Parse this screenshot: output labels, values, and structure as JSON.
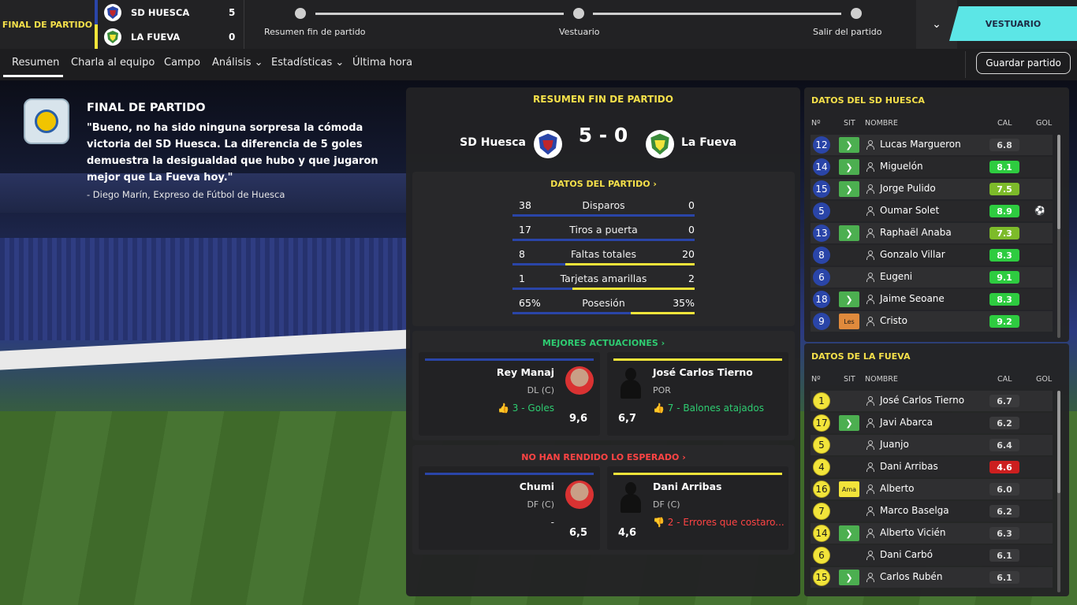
{
  "header": {
    "status": "FINAL DE PARTIDO",
    "home": {
      "name": "SD HUESCA",
      "score": "5",
      "color": "#2a45a8"
    },
    "away": {
      "name": "LA FUEVA",
      "score": "0",
      "color": "#f2e43a"
    },
    "steps": [
      "Resumen fin de partido",
      "Vestuario",
      "Salir del partido"
    ],
    "cta": "VESTUARIO"
  },
  "nav": {
    "tabs": [
      "Resumen",
      "Charla al equipo",
      "Campo",
      "Análisis",
      "Estadísticas",
      "Última hora"
    ],
    "save": "Guardar partido"
  },
  "quote": {
    "title": "FINAL DE PARTIDO",
    "text": "\"Bueno, no ha sido ninguna sorpresa la cómoda victoria del SD Huesca. La diferencia de 5 goles demuestra la desigualdad que hubo y que jugaron mejor que La Fueva hoy.\"",
    "source": "- Diego Marín, Expreso de Fútbol de Huesca"
  },
  "summary": {
    "title": "RESUMEN FIN DE PARTIDO",
    "home_team": "SD Huesca",
    "away_team": "La Fueva",
    "score": "5 - 0",
    "match_data_title": "DATOS DEL PARTIDO",
    "stats": [
      {
        "label": "Disparos",
        "home": "38",
        "away": "0",
        "home_frac": 1.0
      },
      {
        "label": "Tiros a puerta",
        "home": "17",
        "away": "0",
        "home_frac": 1.0
      },
      {
        "label": "Faltas totales",
        "home": "8",
        "away": "20",
        "home_frac": 0.29
      },
      {
        "label": "Tarjetas amarillas",
        "home": "1",
        "away": "2",
        "home_frac": 0.33
      },
      {
        "label": "Posesión",
        "home": "65%",
        "away": "35%",
        "home_frac": 0.65
      }
    ],
    "best_title": "MEJORES ACTUACIONES",
    "best": {
      "home": {
        "name": "Rey Manaj",
        "pos": "DL (C)",
        "stat": "3 - Goles",
        "rating": "9,6"
      },
      "away": {
        "name": "José Carlos Tierno",
        "pos": "POR",
        "stat": "7 - Balones atajados",
        "rating": "6,7"
      }
    },
    "worst_title": "NO HAN RENDIDO LO ESPERADO",
    "worst": {
      "home": {
        "name": "Chumi",
        "pos": "DF (C)",
        "stat": "-",
        "rating": "6,5"
      },
      "away": {
        "name": "Dani Arribas",
        "pos": "DF (C)",
        "stat": "2 - Errores que costaro...",
        "rating": "4,6"
      }
    }
  },
  "columns": {
    "num": "Nº",
    "sit": "SIT",
    "name": "NOMBRE",
    "rating": "CAL",
    "goals": "GOL"
  },
  "home_panel": {
    "title": "DATOS DEL SD HUESCA",
    "players": [
      {
        "num": "12",
        "sit": "sub",
        "name": "Lucas Margueron",
        "rating": "6.8"
      },
      {
        "num": "14",
        "sit": "sub",
        "name": "Miguelón",
        "rating": "8.1"
      },
      {
        "num": "15",
        "sit": "sub",
        "name": "Jorge Pulido",
        "rating": "7.5"
      },
      {
        "num": "5",
        "sit": "",
        "name": "Oumar Solet",
        "rating": "8.9",
        "goal": "⚽"
      },
      {
        "num": "13",
        "sit": "sub",
        "name": "Raphaël Anaba",
        "rating": "7.3"
      },
      {
        "num": "8",
        "sit": "",
        "name": "Gonzalo Villar",
        "rating": "8.3"
      },
      {
        "num": "6",
        "sit": "",
        "name": "Eugeni",
        "rating": "9.1"
      },
      {
        "num": "18",
        "sit": "sub",
        "name": "Jaime Seoane",
        "rating": "8.3"
      },
      {
        "num": "9",
        "sit": "Les",
        "name": "Cristo",
        "rating": "9.2"
      }
    ]
  },
  "away_panel": {
    "title": "DATOS DE LA FUEVA",
    "players": [
      {
        "num": "1",
        "sit": "",
        "name": "José Carlos Tierno",
        "rating": "6.7"
      },
      {
        "num": "17",
        "sit": "sub",
        "name": "Javi Abarca",
        "rating": "6.2"
      },
      {
        "num": "5",
        "sit": "",
        "name": "Juanjo",
        "rating": "6.4"
      },
      {
        "num": "4",
        "sit": "",
        "name": "Dani Arribas",
        "rating": "4.6"
      },
      {
        "num": "16",
        "sit": "Ama",
        "name": "Alberto",
        "rating": "6.0"
      },
      {
        "num": "7",
        "sit": "",
        "name": "Marco Baselga",
        "rating": "6.2"
      },
      {
        "num": "14",
        "sit": "sub",
        "name": "Alberto Vicién",
        "rating": "6.3"
      },
      {
        "num": "6",
        "sit": "",
        "name": "Dani Carbó",
        "rating": "6.1"
      },
      {
        "num": "15",
        "sit": "sub",
        "name": "Carlos Rubén",
        "rating": "6.1"
      }
    ]
  },
  "colors": {
    "accent_yellow": "#f5e04a",
    "cta": "#5ce6e6",
    "positive": "#2ecc71",
    "negative": "#ff4444",
    "home_blue": "#2a45a8",
    "away_yellow": "#f2e43a"
  }
}
